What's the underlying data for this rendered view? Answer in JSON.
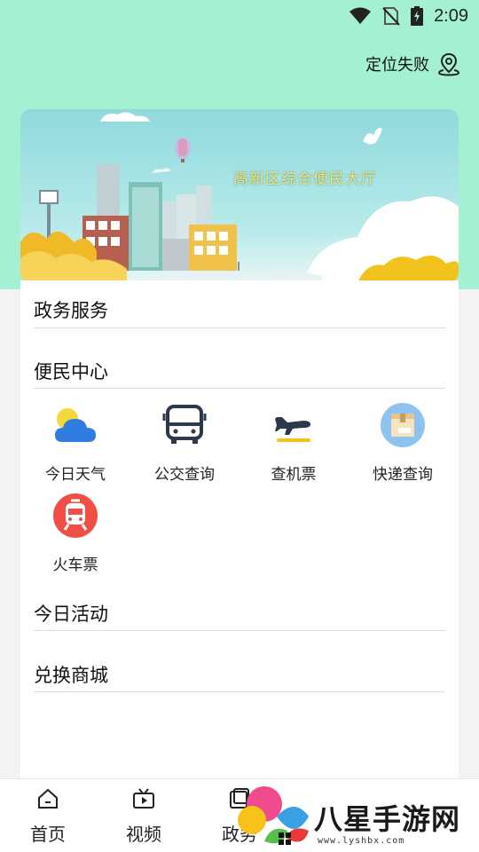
{
  "status_bar": {
    "time": "2:09"
  },
  "header": {
    "location_text": "定位失败"
  },
  "banner": {
    "title": "高新区综合便民大厅"
  },
  "sections": {
    "gov_service": "政务服务",
    "convenience_center": "便民中心",
    "today_activity": "今日活动",
    "exchange_mall": "兑换商城"
  },
  "services": [
    {
      "label": "今日天气",
      "icon": "weather-icon"
    },
    {
      "label": "公交查询",
      "icon": "bus-icon"
    },
    {
      "label": "查机票",
      "icon": "airplane-icon"
    },
    {
      "label": "快递查询",
      "icon": "package-icon"
    },
    {
      "label": "火车票",
      "icon": "train-icon"
    }
  ],
  "bottom_nav": [
    {
      "label": "首页",
      "icon": "home-icon"
    },
    {
      "label": "视频",
      "icon": "video-icon"
    },
    {
      "label": "政务",
      "icon": "gov-icon"
    }
  ],
  "watermark": {
    "text": "八星手游网",
    "sub": "www.lyshbx.com"
  },
  "colors": {
    "top_bg": "#a3f0d2",
    "weather_sun": "#f5d73a",
    "weather_cloud": "#2f7de0",
    "airplane_bar": "#f4c21a",
    "package_bg": "#8fc3ef",
    "train_bg": "#ef4f44"
  }
}
